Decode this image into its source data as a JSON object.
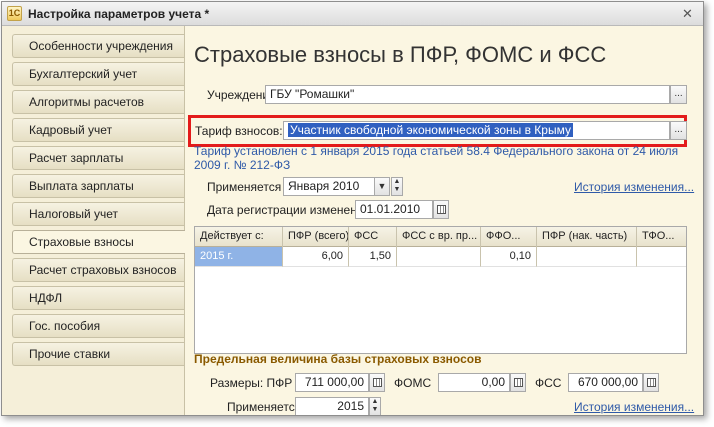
{
  "window": {
    "title": "Настройка параметров учета *",
    "close": "✕"
  },
  "sidebar": {
    "items": [
      {
        "label": "Особенности учреждения"
      },
      {
        "label": "Бухгалтерский учет"
      },
      {
        "label": "Алгоритмы расчетов"
      },
      {
        "label": "Кадровый учет"
      },
      {
        "label": "Расчет зарплаты"
      },
      {
        "label": "Выплата зарплаты"
      },
      {
        "label": "Налоговый учет"
      },
      {
        "label": "Страховые взносы",
        "active": true
      },
      {
        "label": "Расчет страховых взносов"
      },
      {
        "label": "НДФЛ"
      },
      {
        "label": "Гос. пособия"
      },
      {
        "label": "Прочие ставки"
      }
    ]
  },
  "main": {
    "title": "Страховые взносы в ПФР, ФОМС и ФСС",
    "institution": {
      "label": "Учреждение:",
      "value": "ГБУ \"Ромашки\""
    },
    "tariff": {
      "label": "Тариф взносов:",
      "value": "Участник свободной экономической зоны в Крыму"
    },
    "info": "Тариф установлен с 1 января 2015 года статьей 58.4 Федерального закона от 24 июля 2009 г. № 212-ФЗ",
    "applies_from": {
      "label": "Применяется с:",
      "value": "Января  2010"
    },
    "history_link": "История изменения...",
    "reg_date": {
      "label": "Дата регистрации изменений:",
      "value": "01.01.2010"
    },
    "table": {
      "columns": [
        "Действует с:",
        "ПФР (всего)",
        "ФСС",
        "ФСС с вр. пр...",
        "ФФО...",
        "ПФР (нак. часть)",
        "ТФО..."
      ],
      "rows": [
        [
          "2015 г.",
          "6,00",
          "1,50",
          "",
          "0,10",
          "",
          ""
        ]
      ]
    },
    "limit": {
      "title": "Предельная величина базы страховых взносов",
      "sizes_label": "Размеры: ПФР",
      "pfr": "711 000,00",
      "foms_label": "ФОМС",
      "foms": "0,00",
      "fss_label": "ФСС",
      "fss": "670 000,00",
      "applies_label": "Применяется с:",
      "applies_value": "2015",
      "history_link": "История изменения..."
    }
  }
}
